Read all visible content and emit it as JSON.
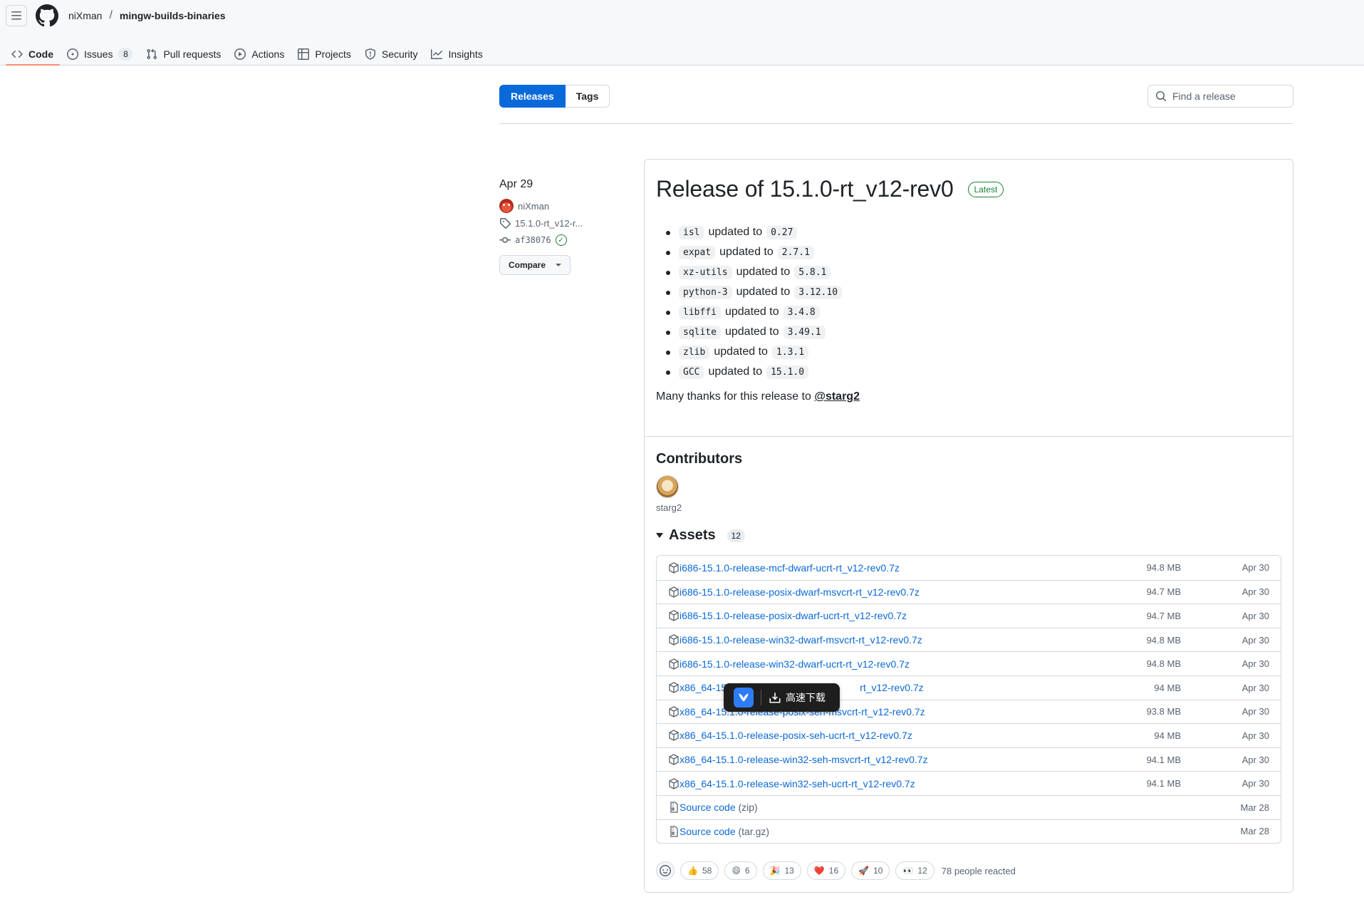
{
  "header": {
    "owner": "niXman",
    "separator": "/",
    "repo": "mingw-builds-binaries"
  },
  "repo_nav": [
    {
      "label": "Code",
      "icon": "code-icon",
      "active": true
    },
    {
      "label": "Issues",
      "icon": "issue-icon",
      "count": "8"
    },
    {
      "label": "Pull requests",
      "icon": "pull-request-icon"
    },
    {
      "label": "Actions",
      "icon": "play-icon"
    },
    {
      "label": "Projects",
      "icon": "table-icon"
    },
    {
      "label": "Security",
      "icon": "shield-icon"
    },
    {
      "label": "Insights",
      "icon": "graph-icon"
    }
  ],
  "subnav": {
    "releases": "Releases",
    "tags": "Tags",
    "search_placeholder": "Find a release"
  },
  "meta": {
    "date": "Apr 29",
    "author": "niXman",
    "tag": "15.1.0-rt_v12-r...",
    "commit": "af38076",
    "compare": "Compare"
  },
  "release": {
    "title": "Release of 15.1.0-rt_v12-rev0",
    "badge": "Latest",
    "notes": [
      {
        "pkg": "isl",
        "text": "updated to",
        "ver": "0.27"
      },
      {
        "pkg": "expat",
        "text": "updated to",
        "ver": "2.7.1"
      },
      {
        "pkg": "xz-utils",
        "text": "updated to",
        "ver": "5.8.1"
      },
      {
        "pkg": "python-3",
        "text": "updated to",
        "ver": "3.12.10"
      },
      {
        "pkg": "libffi",
        "text": "updated to",
        "ver": "3.4.8"
      },
      {
        "pkg": "sqlite",
        "text": "updated to",
        "ver": "3.49.1"
      },
      {
        "pkg": "zlib",
        "text": "updated to",
        "ver": "1.3.1"
      },
      {
        "pkg": "GCC",
        "text": "updated to",
        "ver": "15.1.0"
      }
    ],
    "thanks_text": "Many thanks for this release to",
    "thanks_user": "@starg2"
  },
  "contributors": {
    "title": "Contributors",
    "name": "starg2"
  },
  "assets": {
    "title": "Assets",
    "count": "12",
    "items": [
      {
        "name": "i686-15.1.0-release-mcf-dwarf-ucrt-rt_v12-rev0.7z",
        "size": "94.8 MB",
        "date": "Apr 30"
      },
      {
        "name": "i686-15.1.0-release-posix-dwarf-msvcrt-rt_v12-rev0.7z",
        "size": "94.7 MB",
        "date": "Apr 30"
      },
      {
        "name": "i686-15.1.0-release-posix-dwarf-ucrt-rt_v12-rev0.7z",
        "size": "94.7 MB",
        "date": "Apr 30"
      },
      {
        "name": "i686-15.1.0-release-win32-dwarf-msvcrt-rt_v12-rev0.7z",
        "size": "94.8 MB",
        "date": "Apr 30"
      },
      {
        "name": "i686-15.1.0-release-win32-dwarf-ucrt-rt_v12-rev0.7z",
        "size": "94.8 MB",
        "date": "Apr 30"
      },
      {
        "name": "x86_64-15",
        "name_tail": "rt_v12-rev0.7z",
        "size": "94 MB",
        "date": "Apr 30"
      },
      {
        "name": "x86_64-15.1.0-release-posix-seh-msvcrt-rt_v12-rev0.7z",
        "size": "93.8 MB",
        "date": "Apr 30"
      },
      {
        "name": "x86_64-15.1.0-release-posix-seh-ucrt-rt_v12-rev0.7z",
        "size": "94 MB",
        "date": "Apr 30"
      },
      {
        "name": "x86_64-15.1.0-release-win32-seh-msvcrt-rt_v12-rev0.7z",
        "size": "94.1 MB",
        "date": "Apr 30"
      },
      {
        "name": "x86_64-15.1.0-release-win32-seh-ucrt-rt_v12-rev0.7z",
        "size": "94.1 MB",
        "date": "Apr 30"
      }
    ],
    "source": [
      {
        "name": "Source code",
        "ext": "(zip)",
        "date": "Mar 28"
      },
      {
        "name": "Source code",
        "ext": "(tar.gz)",
        "date": "Mar 28"
      }
    ]
  },
  "reactions": {
    "items": [
      {
        "emoji": "👍",
        "count": "58"
      },
      {
        "emoji": "😄",
        "count": "6"
      },
      {
        "emoji": "🎉",
        "count": "13"
      },
      {
        "emoji": "❤️",
        "count": "16"
      },
      {
        "emoji": "🚀",
        "count": "10"
      },
      {
        "emoji": "👀",
        "count": "12"
      }
    ],
    "summary": "78 people reacted"
  },
  "download_overlay": {
    "label": "高速下载"
  }
}
